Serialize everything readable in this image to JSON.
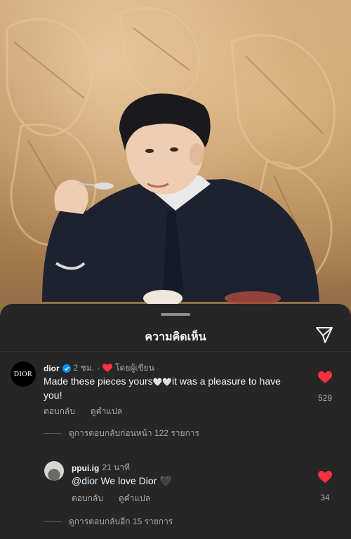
{
  "sheet": {
    "title": "ความคิดเห็น"
  },
  "icons": {
    "send": "paper-plane-icon",
    "verified": "verified-badge-icon",
    "heart": "heart-icon"
  },
  "colors": {
    "heart": "#ff3040",
    "verified": "#0095f6",
    "sheet_bg": "#262626"
  },
  "comments": [
    {
      "username": "dior",
      "avatar_label": "DIOR",
      "time": "2 ชม.",
      "separator": "·",
      "author_liked": "โดยผู้เขียน",
      "text": "Made these pieces yours",
      "emoji": "🤍🤍",
      "text_rest": "it was a pleasure to have you!",
      "reply_label": "ตอบกลับ",
      "translate_label": "ดูคำแปล",
      "likes": "529",
      "view_replies": "ดูการตอบกลับก่อนหน้า 122 รายการ"
    },
    {
      "username": "ppui.ig",
      "time": "21 นาที",
      "mention": "@dior",
      "text": "We love Dior",
      "emoji": "🖤",
      "reply_label": "ตอบกลับ",
      "translate_label": "ดูคำแปล",
      "likes": "34",
      "view_replies": "ดูการตอบกลับอีก 15 รายการ"
    }
  ]
}
